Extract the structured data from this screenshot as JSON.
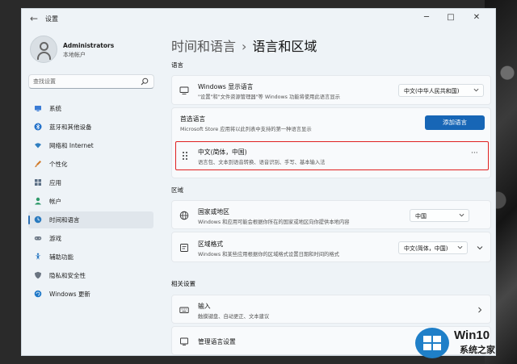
{
  "window": {
    "app_title": "设置",
    "back_glyph": "←",
    "controls": {
      "minimize": "─",
      "maximize": "□",
      "close": "✕"
    }
  },
  "user": {
    "name": "Administrators",
    "account_type": "本地帐户"
  },
  "search": {
    "placeholder": "查找设置",
    "icon": "search-icon"
  },
  "sidebar": {
    "items": [
      {
        "label": "系统",
        "icon": "monitor-icon",
        "color": "#3a7bd5"
      },
      {
        "label": "蓝牙和其他设备",
        "icon": "bluetooth-icon",
        "color": "#1f6fc9"
      },
      {
        "label": "网络和 Internet",
        "icon": "wifi-icon",
        "color": "#2f7ec0"
      },
      {
        "label": "个性化",
        "icon": "brush-icon",
        "color": "#d07a2a"
      },
      {
        "label": "应用",
        "icon": "apps-icon",
        "color": "#5a6e84"
      },
      {
        "label": "帐户",
        "icon": "person-icon",
        "color": "#2e9a6a"
      },
      {
        "label": "时间和语言",
        "icon": "globe-clock-icon",
        "color": "#2b7bbf",
        "active": true
      },
      {
        "label": "游戏",
        "icon": "gamepad-icon",
        "color": "#6b7785"
      },
      {
        "label": "辅助功能",
        "icon": "accessibility-icon",
        "color": "#2b79c2"
      },
      {
        "label": "隐私和安全性",
        "icon": "shield-icon",
        "color": "#6a7480"
      },
      {
        "label": "Windows 更新",
        "icon": "update-icon",
        "color": "#1e78c8"
      }
    ]
  },
  "header": {
    "parent": "时间和语言",
    "separator": "›",
    "current": "语言和区域"
  },
  "sections": {
    "language": {
      "label": "语言",
      "display_language": {
        "title": "Windows 显示语言",
        "subtitle": "\"设置\"和\"文件资源管理器\"等 Windows 功能将使用此语言显示",
        "value": "中文(中华人民共和国)"
      },
      "preferred": {
        "title": "首选语言",
        "subtitle": "Microsoft Store 应用将以此列表中支持的第一种语言显示",
        "button": "添加语言"
      },
      "installed": {
        "title": "中文(简体，中国)",
        "subtitle": "语言包、文本到语音转换、语音识别、手写、基本输入法",
        "more": "···"
      }
    },
    "region": {
      "label": "区域",
      "country": {
        "title": "国家或地区",
        "subtitle": "Windows 和应用可能会根据你所在的国家或地区向你提供本地内容",
        "value": "中国"
      },
      "format": {
        "title": "区域格式",
        "subtitle": "Windows 和某些应用根据你的区域格式设置日期和时间的格式",
        "value": "中文(简体，中国)"
      }
    },
    "related": {
      "label": "相关设置",
      "input": {
        "title": "输入",
        "subtitle": "触摸键盘、自动更正、文本建议"
      },
      "admin": {
        "title": "管理语言设置"
      }
    }
  },
  "watermark": {
    "title": "Win10",
    "subtitle": "系统之家"
  },
  "colors": {
    "accent": "#1766b6",
    "highlight_border": "#e02020"
  }
}
